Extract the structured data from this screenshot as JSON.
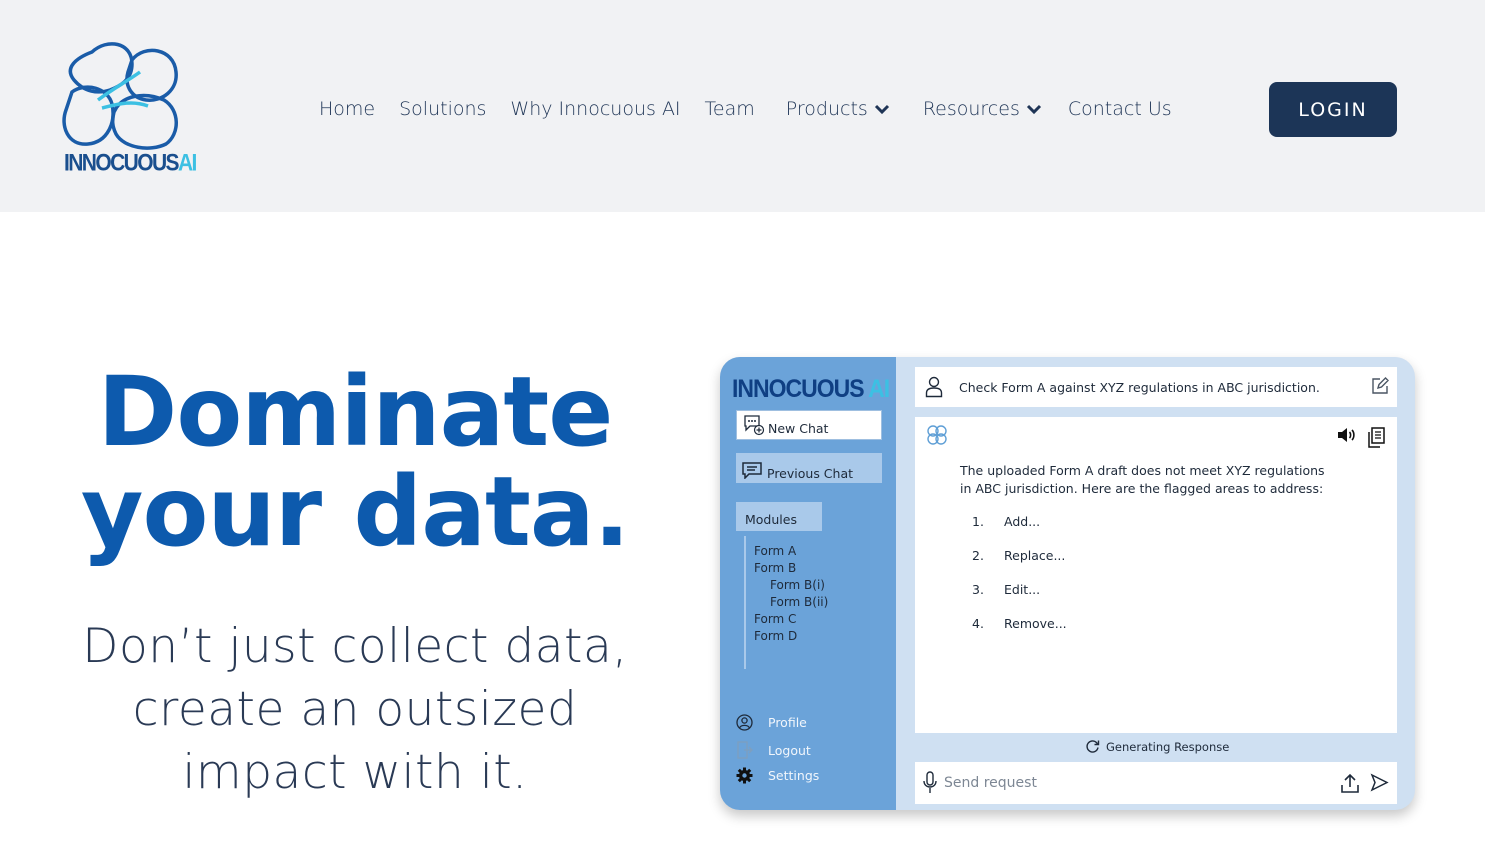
{
  "brand": {
    "name_main": "INNOCUOUS",
    "name_accent": "AI"
  },
  "nav": {
    "home": "Home",
    "solutions": "Solutions",
    "why": "Why Innocuous AI",
    "team": "Team",
    "products": "Products",
    "resources": "Resources",
    "contact": "Contact Us",
    "login": "LOGIN"
  },
  "hero": {
    "title_line1": "Dominate",
    "title_line2": "your data.",
    "sub_line1": "Don’t just collect data,",
    "sub_line2": "create an outsized",
    "sub_line3": "impact with it."
  },
  "mockup": {
    "brand_main": "INNOCUOUS",
    "brand_accent": "AI",
    "new_chat": "New Chat",
    "previous_chat": "Previous Chat",
    "modules": "Modules",
    "forms": {
      "a": "Form A",
      "b": "Form B",
      "bi": "Form B(i)",
      "bii": "Form B(ii)",
      "c": "Form C",
      "d": "Form D"
    },
    "profile": "Profile",
    "logout": "Logout",
    "settings": "Settings",
    "query": "Check Form A against XYZ regulations in ABC jurisdiction.",
    "response_intro": "The uploaded Form A draft does not meet XYZ regulations in ABC jurisdiction. Here are the flagged areas to address:",
    "items": [
      {
        "num": "1.",
        "text": "Add..."
      },
      {
        "num": "2.",
        "text": "Replace..."
      },
      {
        "num": "3.",
        "text": "Edit..."
      },
      {
        "num": "4.",
        "text": "Remove..."
      }
    ],
    "generating": "Generating Response",
    "input_placeholder": "Send request"
  },
  "colors": {
    "header_bg": "#f1f2f4",
    "nav_text": "#1f3556",
    "login_bg": "#1c3557",
    "hero_title": "#0d5aad",
    "hero_sub": "#2a3a55",
    "logo_dark": "#1a4f8e",
    "logo_accent": "#3cc0e3",
    "mock_sidebar": "#6ba3d9",
    "mock_bg": "#cfe0f2"
  },
  "icons": [
    "chevron-down-icon",
    "new-chat-icon",
    "chat-bubble-icon",
    "user-icon",
    "edit-icon",
    "speaker-icon",
    "document-icon",
    "refresh-icon",
    "microphone-icon",
    "upload-icon",
    "send-icon",
    "profile-icon",
    "logout-icon",
    "gear-icon"
  ]
}
